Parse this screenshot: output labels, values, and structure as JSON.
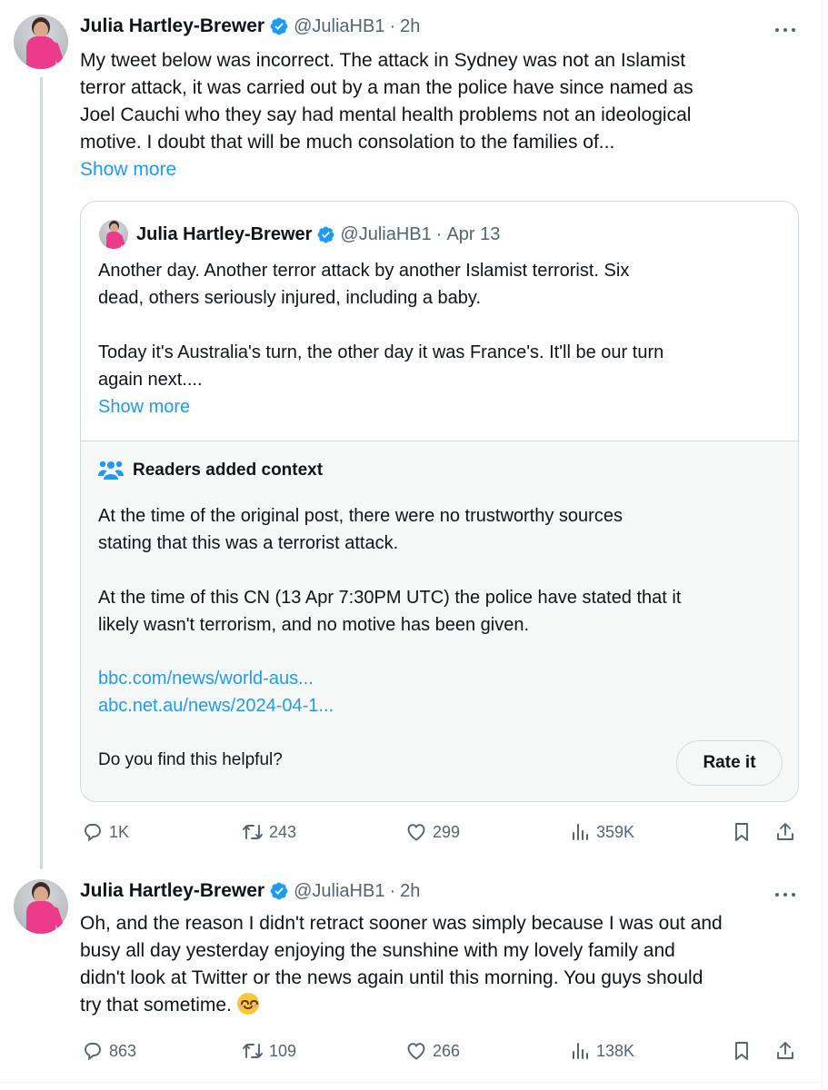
{
  "colors": {
    "accent": "#1d9bf0",
    "text_primary": "#0f1419",
    "text_secondary": "#536471",
    "note_background": "#f7f9f9",
    "border": "#cfd9de"
  },
  "tweets": [
    {
      "author_name": "Julia Hartley-Brewer",
      "verified": true,
      "handle": "@JuliaHB1",
      "separator": "·",
      "time": "2h",
      "text": "My tweet below was incorrect. The attack in Sydney was not an Islamist\nterror attack, it was carried out by a man the police have since named as\nJoel Cauchi who they say had mental health problems not an ideological\nmotive. I doubt that will be much consolation to the families of...",
      "show_more": "Show more",
      "quoted_tweet": {
        "author_name": "Julia Hartley-Brewer",
        "verified": true,
        "handle": "@JuliaHB1",
        "separator": "·",
        "time": "Apr 13",
        "text": "Another day. Another terror attack by another Islamist terrorist. Six\ndead, others seriously injured, including a baby.\n\nToday it's Australia's turn, the other day it was France's. It'll be our turn\nagain next....",
        "show_more": "Show more",
        "community_note": {
          "icon": "people-icon",
          "title": "Readers added context",
          "text": "At the time of the original post, there were no trustworthy sources\nstating that this was a terrorist attack.\n\nAt the time of this CN (13 Apr 7:30PM UTC) the police have stated that it\nlikely wasn't terrorism, and no motive has been given.",
          "links": [
            "bbc.com/news/world-aus...",
            "abc.net.au/news/2024-04-1..."
          ],
          "helpful_prompt": "Do you find this helpful?",
          "rate_button": "Rate it"
        }
      },
      "actions": {
        "replies": "1K",
        "reposts": "243",
        "likes": "299",
        "views": "359K"
      }
    },
    {
      "author_name": "Julia Hartley-Brewer",
      "verified": true,
      "handle": "@JuliaHB1",
      "separator": "·",
      "time": "2h",
      "text": "Oh, and the reason I didn't retract sooner was simply because I was out and\nbusy all day yesterday enjoying the sunshine with my lovely family and\ndidn't look at Twitter or the news again until this morning. You guys should\ntry that sometime. ",
      "emoji": "smiling-face-with-smiling-eyes",
      "actions": {
        "replies": "863",
        "reposts": "109",
        "likes": "266",
        "views": "138K"
      }
    }
  ]
}
